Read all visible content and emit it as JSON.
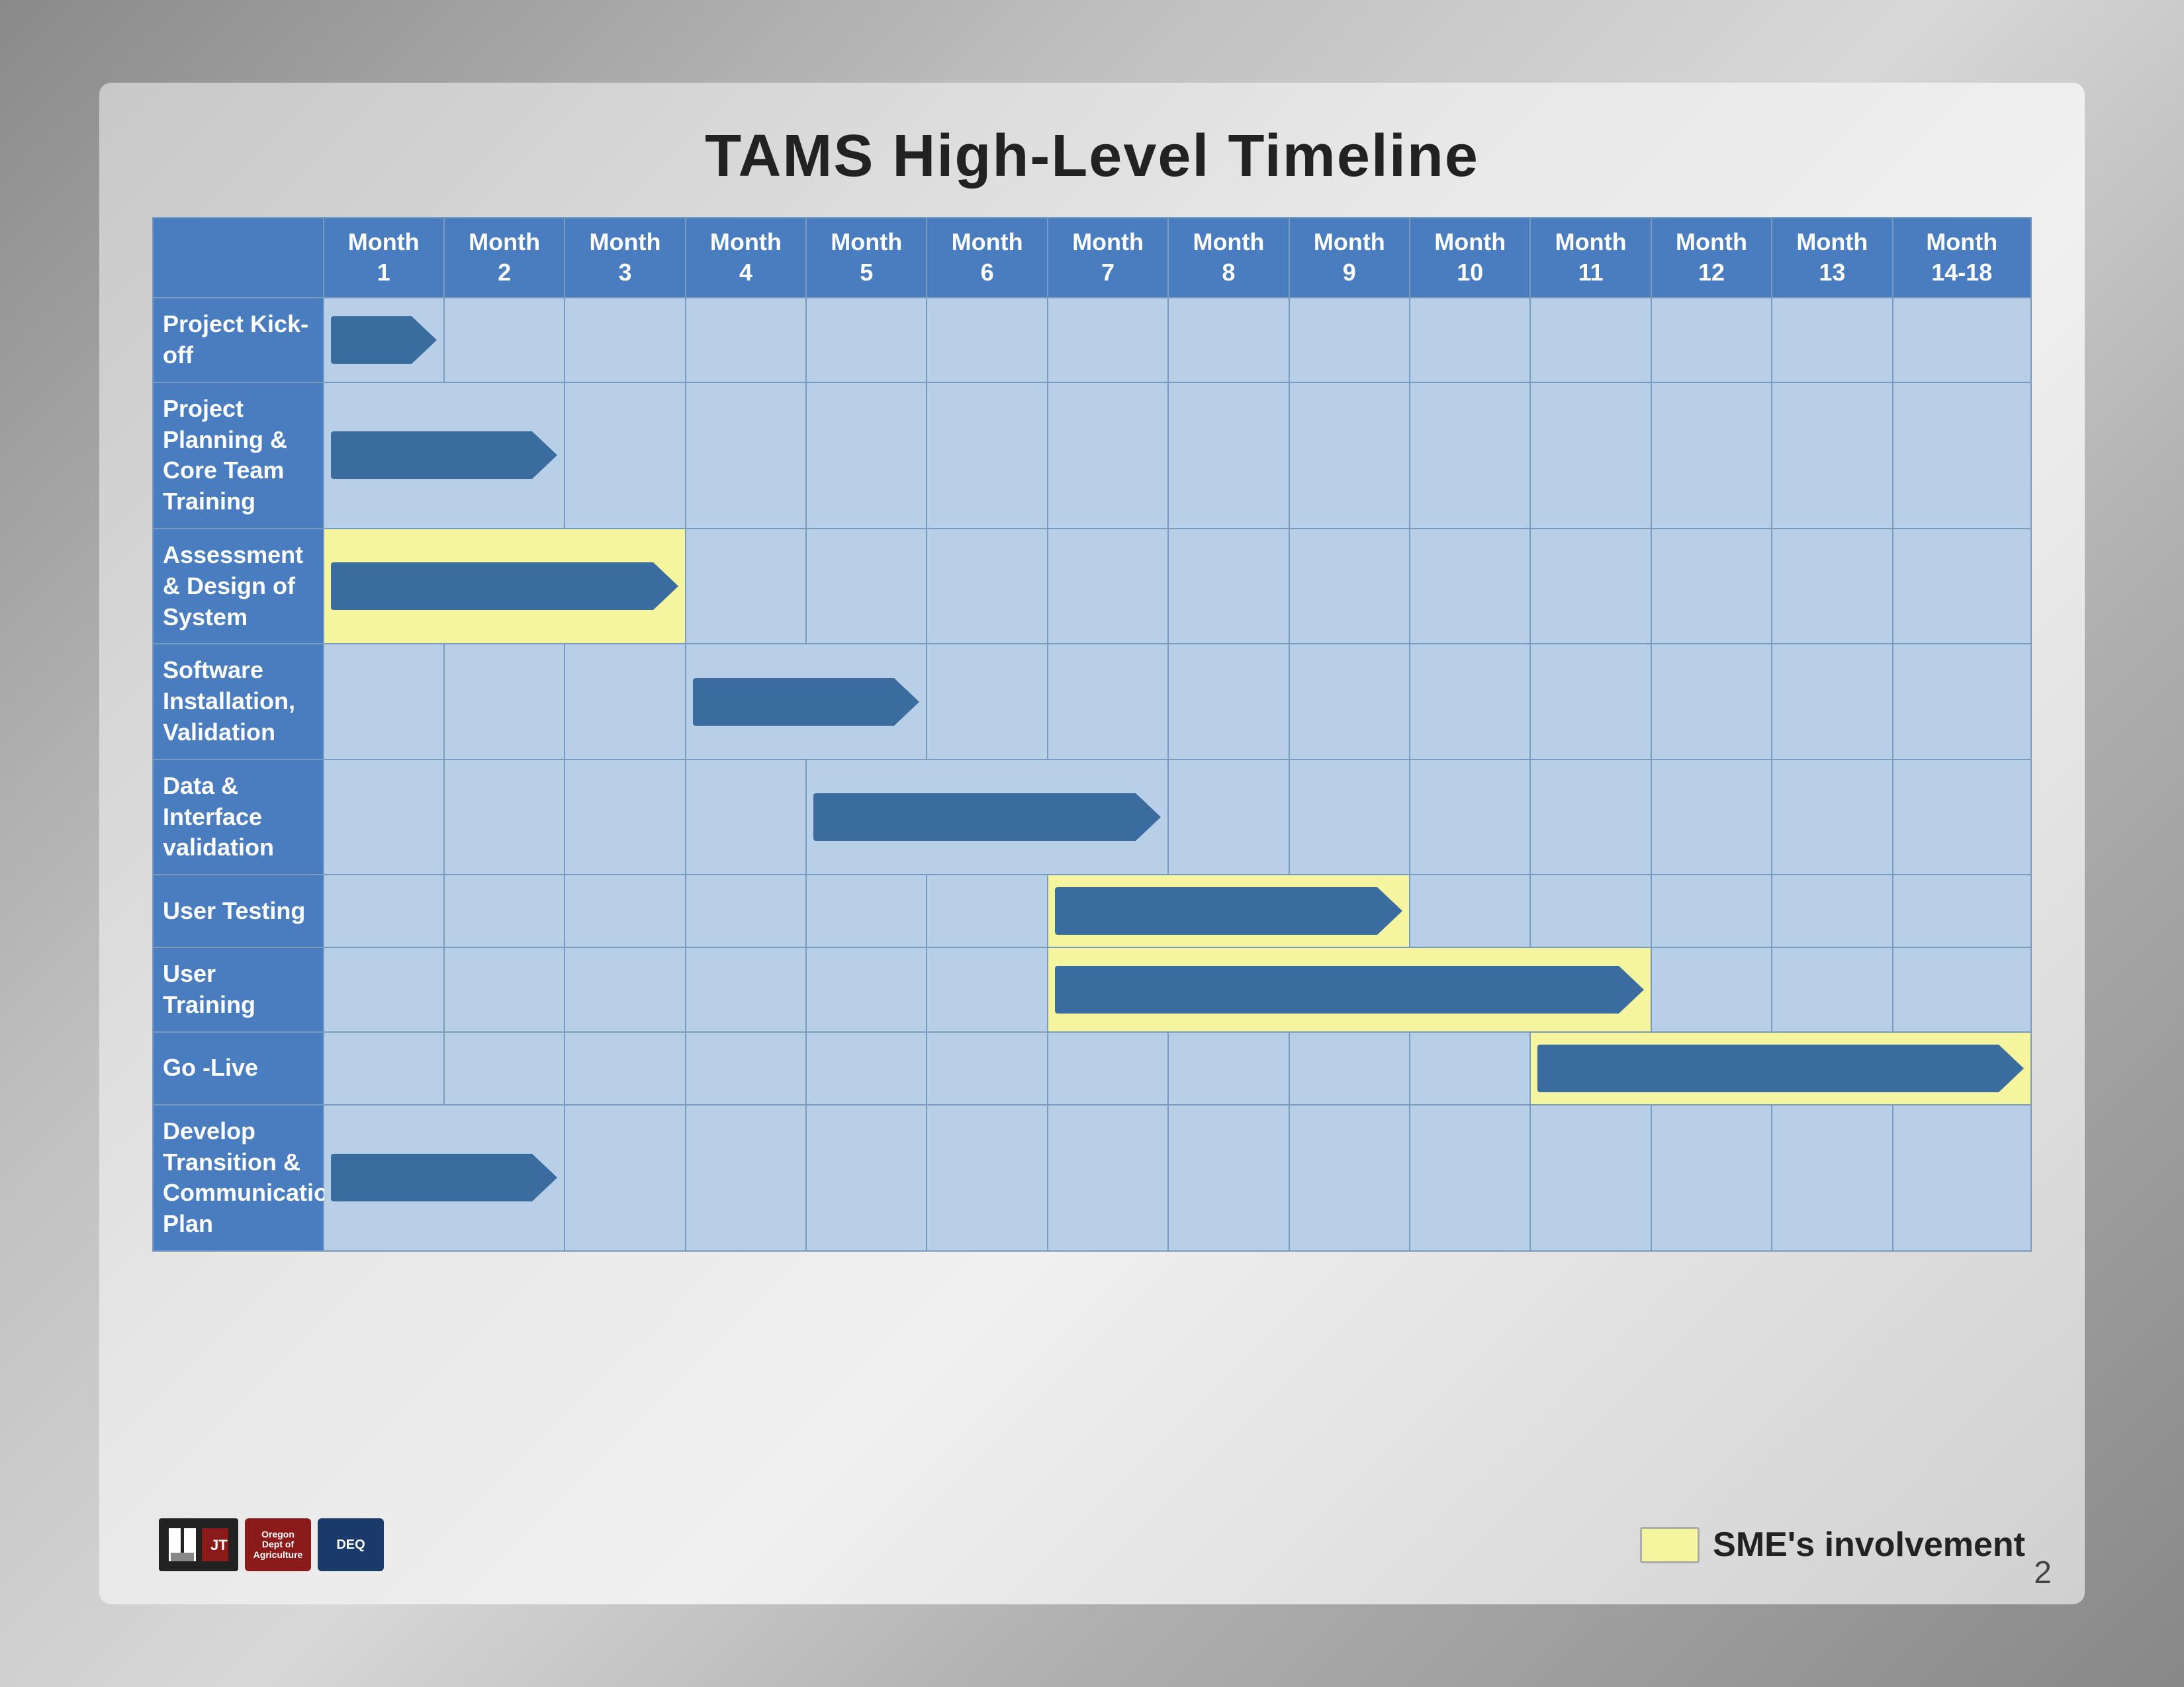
{
  "title": "TAMS High-Level Timeline",
  "months": [
    {
      "label": "Month",
      "sub": "1"
    },
    {
      "label": "Month",
      "sub": "2"
    },
    {
      "label": "Month",
      "sub": "3"
    },
    {
      "label": "Month",
      "sub": "4"
    },
    {
      "label": "Month",
      "sub": "5"
    },
    {
      "label": "Month",
      "sub": "6"
    },
    {
      "label": "Month",
      "sub": "7"
    },
    {
      "label": "Month",
      "sub": "8"
    },
    {
      "label": "Month",
      "sub": "9"
    },
    {
      "label": "Month",
      "sub": "10"
    },
    {
      "label": "Month",
      "sub": "11"
    },
    {
      "label": "Month",
      "sub": "12"
    },
    {
      "label": "Month",
      "sub": "13"
    },
    {
      "label": "Month",
      "sub": "14-18"
    }
  ],
  "rows": [
    {
      "label": "Project Kick-off",
      "arrow_start": 1,
      "arrow_span": 1,
      "yellow": false
    },
    {
      "label": "Project Planning & Core Team Training",
      "arrow_start": 1,
      "arrow_span": 2,
      "yellow": false
    },
    {
      "label": "Assessment & Design of System",
      "arrow_start": 1,
      "arrow_span": 3,
      "yellow": true
    },
    {
      "label": "Software Installation, Validation",
      "arrow_start": 4,
      "arrow_span": 2,
      "yellow": false
    },
    {
      "label": "Data & Interface validation",
      "arrow_start": 5,
      "arrow_span": 3,
      "yellow": false
    },
    {
      "label": "User Testing",
      "arrow_start": 7,
      "arrow_span": 3,
      "yellow": true
    },
    {
      "label": "User Training",
      "arrow_start": 7,
      "arrow_span": 5,
      "yellow": true
    },
    {
      "label": "Go -Live",
      "arrow_start": 11,
      "arrow_span": 4,
      "yellow": true
    },
    {
      "label": "Develop Transition & Communication Plan",
      "arrow_start": 1,
      "arrow_span": 2,
      "yellow": false
    }
  ],
  "legend": {
    "box_color": "#f5f5a0",
    "label": "SME's involvement"
  },
  "page_number": "2"
}
